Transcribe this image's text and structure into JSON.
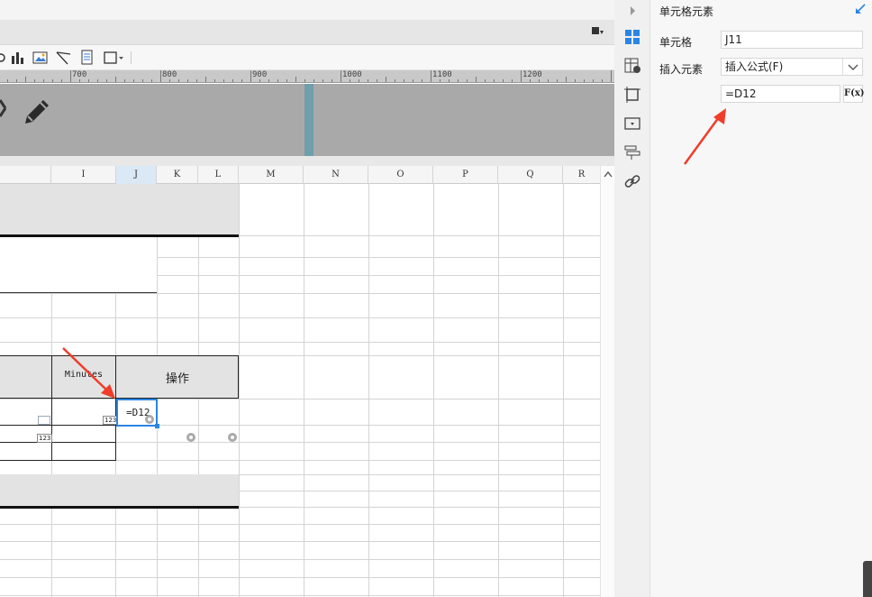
{
  "ruler": {
    "labels": [
      "700",
      "800",
      "900",
      "1000",
      "1100",
      "1200"
    ]
  },
  "columns": [
    "I",
    "J",
    "K",
    "L",
    "M",
    "N",
    "O",
    "P",
    "Q",
    "R"
  ],
  "sheet": {
    "header_minutes": "Minutes",
    "header_operation": "操作",
    "badge_123": "123",
    "active_cell_value": "=D12"
  },
  "panel": {
    "title": "单元格元素",
    "cell_label": "单元格",
    "cell_value": "J11",
    "insert_label": "插入元素",
    "insert_value": "插入公式(F)",
    "formula_value": "=D12",
    "formula_button": "F(x)"
  },
  "icons": {
    "collapse": "chevron-right-icon",
    "undock": "arrow-pin-icon",
    "side": [
      "cell-element-icon",
      "cell-attribute-icon",
      "border-icon",
      "widget-icon",
      "condition-icon",
      "hyperlink-icon"
    ]
  },
  "colors": {
    "accent": "#2b85e4",
    "arrow": "#f03c2a",
    "header_fill": "#e3e3e3"
  }
}
